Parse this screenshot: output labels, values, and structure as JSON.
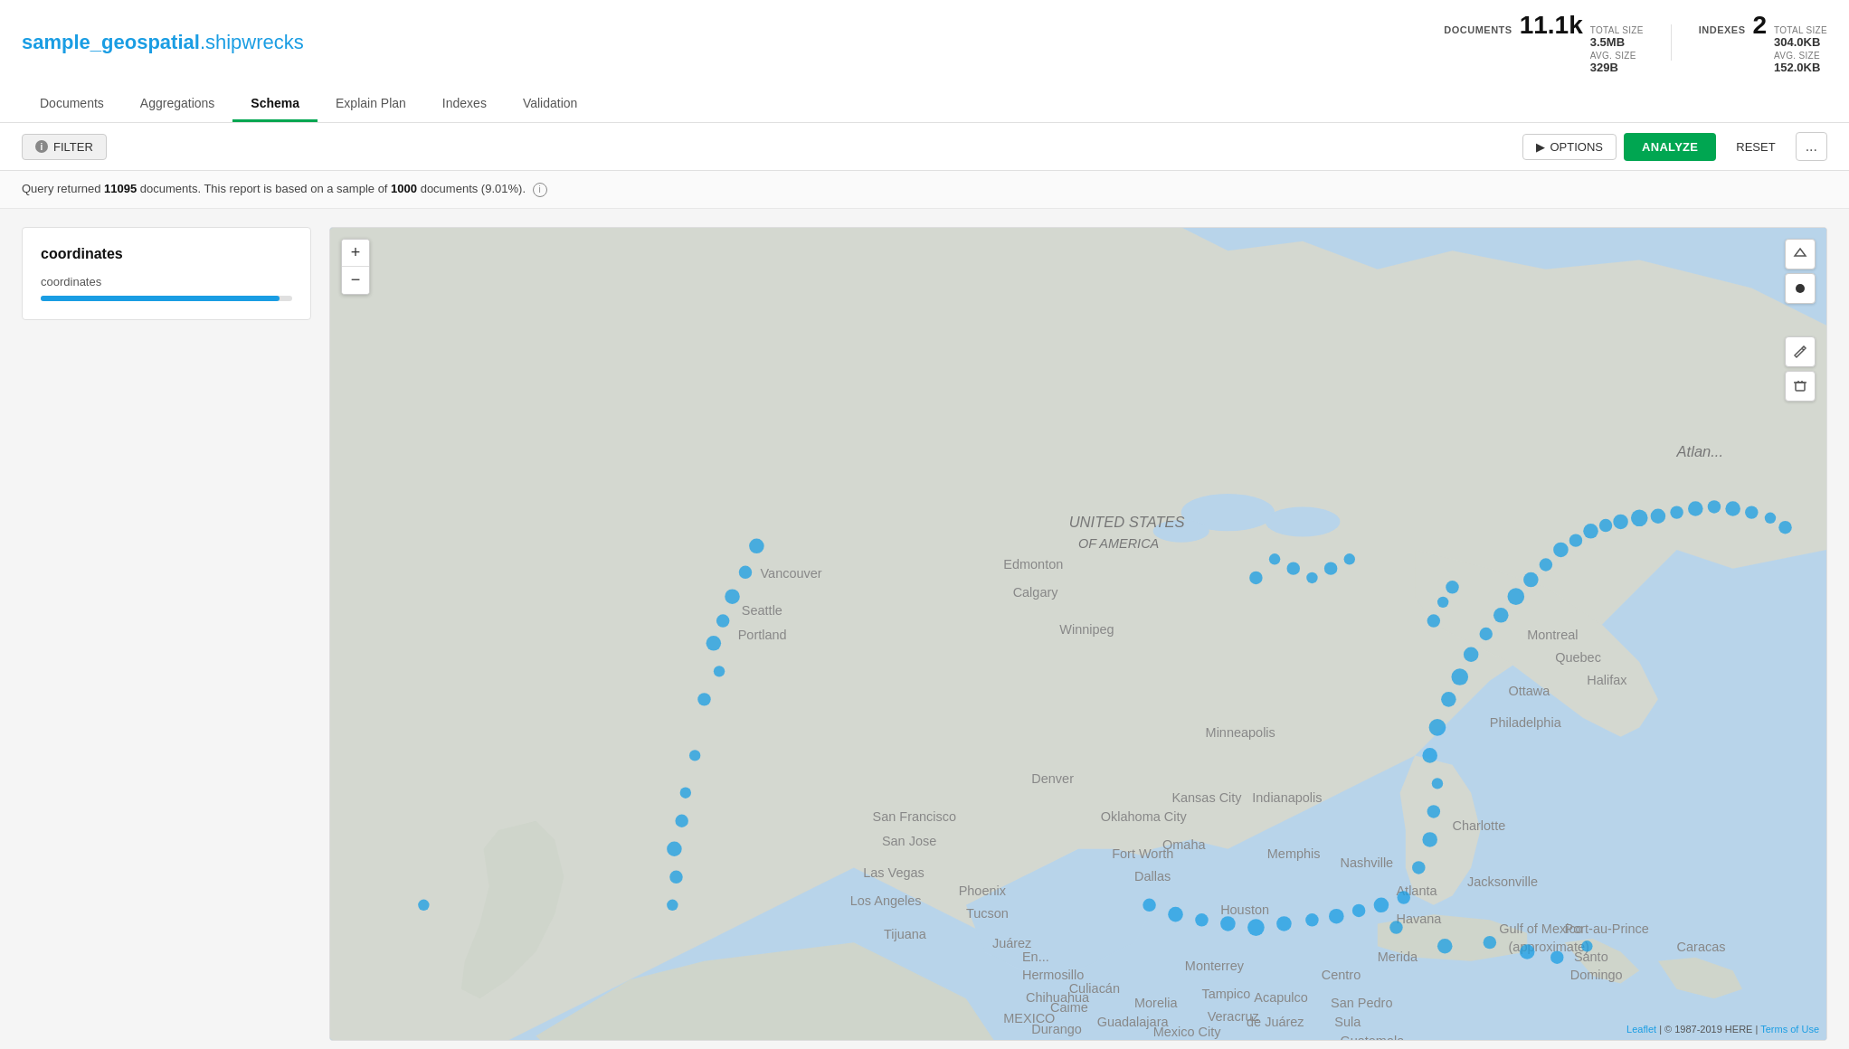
{
  "header": {
    "db_name": "sample_geospatial",
    "separator": ".",
    "coll_name": "shipwrecks",
    "stats": {
      "documents_label": "DOCUMENTS",
      "documents_value": "11.1k",
      "total_size_label": "TOTAL SIZE",
      "total_size_value": "3.5MB",
      "avg_size_label": "AVG. SIZE",
      "avg_size_value": "329B",
      "indexes_label": "INDEXES",
      "indexes_value": "2",
      "indexes_total_size_label": "TOTAL SIZE",
      "indexes_total_size_value": "304.0KB",
      "indexes_avg_size_label": "AVG. SIZE",
      "indexes_avg_size_value": "152.0KB"
    }
  },
  "tabs": [
    {
      "id": "documents",
      "label": "Documents",
      "active": false
    },
    {
      "id": "aggregations",
      "label": "Aggregations",
      "active": false
    },
    {
      "id": "schema",
      "label": "Schema",
      "active": true
    },
    {
      "id": "explain-plan",
      "label": "Explain Plan",
      "active": false
    },
    {
      "id": "indexes",
      "label": "Indexes",
      "active": false
    },
    {
      "id": "validation",
      "label": "Validation",
      "active": false
    }
  ],
  "toolbar": {
    "filter_label": "FILTER",
    "options_label": "OPTIONS",
    "analyze_label": "ANALYZE",
    "reset_label": "RESET",
    "more_label": "..."
  },
  "info_bar": {
    "prefix": "Query returned",
    "count": "11095",
    "middle": "documents. This report is based on a sample of",
    "sample": "1000",
    "suffix": "documents (9.01%)."
  },
  "schema": {
    "field_title": "coordinates",
    "field_type": "coordinates",
    "field_bar_width": "95"
  },
  "map": {
    "zoom_in": "+",
    "zoom_out": "−",
    "attribution_leaflet": "Leaflet",
    "attribution_here": "© 1987-2019 HERE",
    "attribution_terms": "Terms of Use"
  }
}
